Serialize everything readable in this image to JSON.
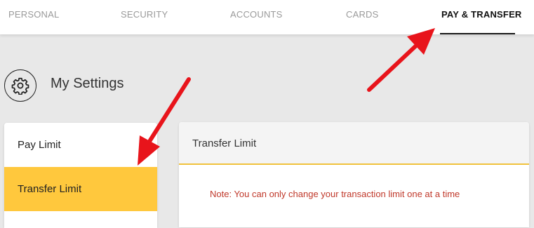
{
  "topnav": {
    "tabs": [
      {
        "label": "PERSONAL"
      },
      {
        "label": "SECURITY"
      },
      {
        "label": "ACCOUNTS"
      },
      {
        "label": "CARDS"
      },
      {
        "label": "PAY & TRANSFER",
        "active": true
      }
    ]
  },
  "settings": {
    "icon": "gear-icon",
    "title": "My Settings"
  },
  "sidebar": {
    "items": [
      {
        "label": "Pay Limit"
      },
      {
        "label": "Transfer Limit",
        "active": true
      }
    ],
    "active_color": "#ffc83d"
  },
  "panel": {
    "title": "Transfer Limit",
    "note": "Note: You can only change your transaction limit one at a time",
    "note_color": "#c0392b",
    "header_border_color": "#f0c23b"
  },
  "annotations": {
    "arrow_color": "#e8141b"
  }
}
